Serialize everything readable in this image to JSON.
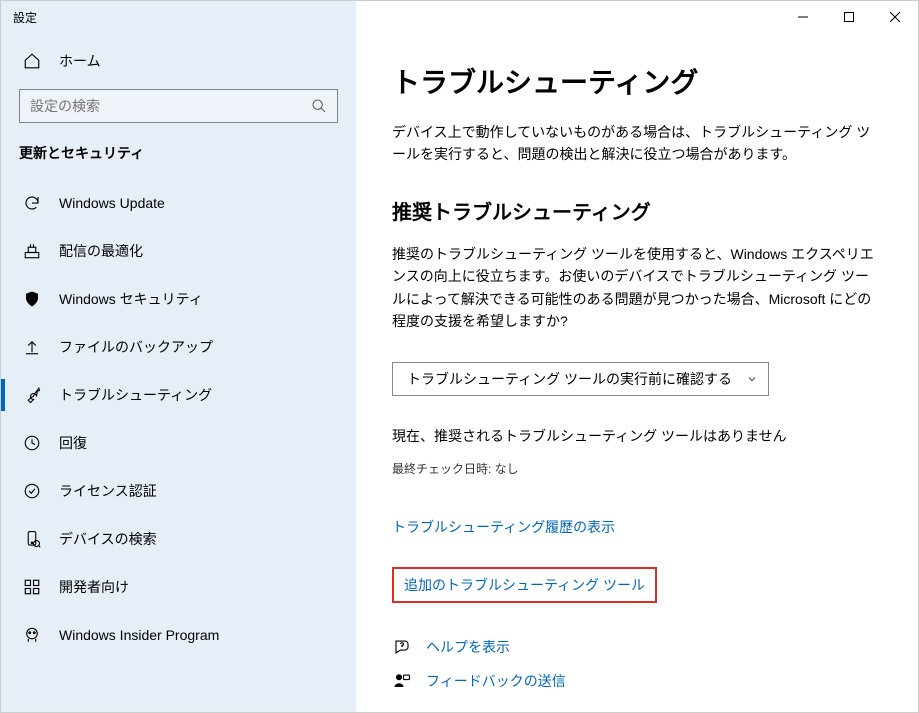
{
  "window": {
    "title": "設定"
  },
  "sidebar": {
    "home": "ホーム",
    "search_placeholder": "設定の検索",
    "category": "更新とセキュリティ",
    "items": [
      {
        "label": "Windows Update",
        "icon": "sync"
      },
      {
        "label": "配信の最適化",
        "icon": "delivery"
      },
      {
        "label": "Windows セキュリティ",
        "icon": "shield"
      },
      {
        "label": "ファイルのバックアップ",
        "icon": "backup"
      },
      {
        "label": "トラブルシューティング",
        "icon": "wrench",
        "active": true
      },
      {
        "label": "回復",
        "icon": "recovery"
      },
      {
        "label": "ライセンス認証",
        "icon": "check-circle"
      },
      {
        "label": "デバイスの検索",
        "icon": "find-device"
      },
      {
        "label": "開発者向け",
        "icon": "developer"
      },
      {
        "label": "Windows Insider Program",
        "icon": "insider"
      }
    ]
  },
  "content": {
    "heading": "トラブルシューティング",
    "intro": "デバイス上で動作していないものがある場合は、トラブルシューティング ツールを実行すると、問題の検出と解決に役立つ場合があります。",
    "section_heading": "推奨トラブルシューティング",
    "section_body": "推奨のトラブルシューティング ツールを使用すると、Windows エクスペリエンスの向上に役立ちます。お使いのデバイスでトラブルシューティング ツールによって解決できる可能性のある問題が見つかった場合、Microsoft にどの程度の支援を希望しますか?",
    "dropdown_value": "トラブルシューティング ツールの実行前に確認する",
    "status": "現在、推奨されるトラブルシューティング ツールはありません",
    "last_checked": "最終チェック日時: なし",
    "link_history": "トラブルシューティング履歴の表示",
    "link_additional": "追加のトラブルシューティング ツール",
    "help": "ヘルプを表示",
    "feedback": "フィードバックの送信"
  }
}
